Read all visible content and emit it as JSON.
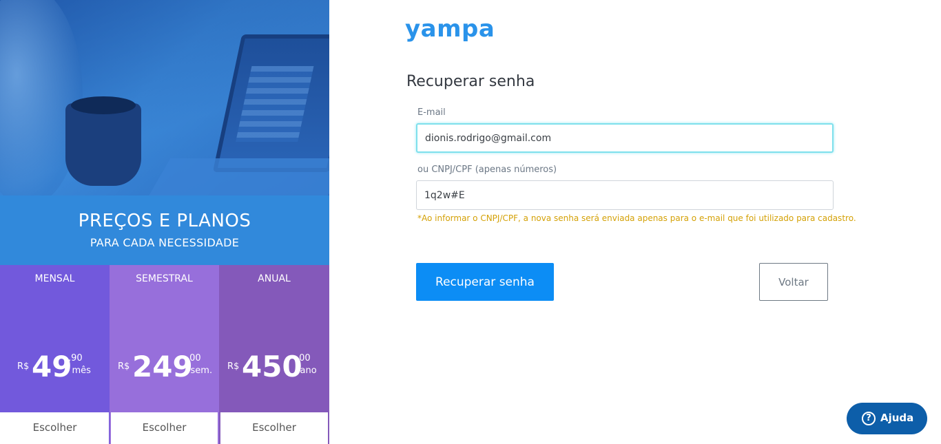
{
  "promo": {
    "title": "PREÇOS E PLANOS",
    "subtitle": "PARA CADA NECESSIDADE",
    "plans": [
      {
        "name": "MENSAL",
        "currency": "R$",
        "amount": "49",
        "cents": ",90",
        "period": "/ mês",
        "choose_label": "Escolher",
        "color": "#7259dc"
      },
      {
        "name": "SEMESTRAL",
        "currency": "R$",
        "amount": "249",
        "cents": ",00",
        "period": "/ sem.",
        "choose_label": "Escolher",
        "color": "#976fdb"
      },
      {
        "name": "ANUAL",
        "currency": "R$",
        "amount": "450",
        "cents": ",00",
        "period": "/ ano",
        "choose_label": "Escolher",
        "color": "#8459ba"
      }
    ]
  },
  "brand": {
    "logo": "yampa",
    "color": "#2a93ea"
  },
  "form": {
    "title": "Recuperar senha",
    "email_label": "E-mail",
    "email_value": "dionis.rodrigo@gmail.com",
    "doc_label": "ou CNPJ/CPF (apenas números)",
    "doc_value": "1q2w#E",
    "hint": "*Ao informar o CNPJ/CPF, a nova senha será enviada apenas para o e-mail que foi utilizado para cadastro.",
    "submit_label": "Recuperar senha",
    "back_label": "Voltar"
  },
  "help": {
    "icon": "question-circle-icon",
    "label": "Ajuda"
  }
}
